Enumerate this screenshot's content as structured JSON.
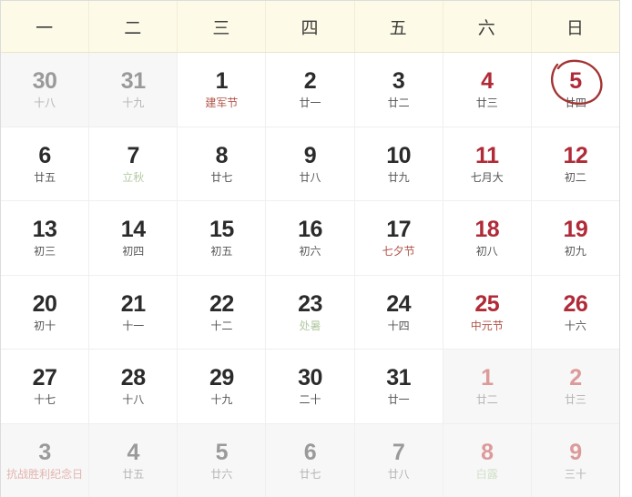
{
  "header": {
    "weekdays": [
      "一",
      "二",
      "三",
      "四",
      "五",
      "六",
      "日"
    ]
  },
  "colors": {
    "header_bg": "#fdfbe7",
    "out_bg": "#f7f7f7",
    "weekend_num": "#b02a37",
    "festival_text": "#b2554b",
    "solar_term_text": "#b4c9a4",
    "today_circle": "#a33434",
    "grid_line": "#efefef"
  },
  "today": {
    "number": "5",
    "marker": "circle"
  },
  "weeks": [
    [
      {
        "num": "30",
        "sub": "十八",
        "sub_type": "lunar",
        "out": true,
        "weekend": false,
        "today": false
      },
      {
        "num": "31",
        "sub": "十九",
        "sub_type": "lunar",
        "out": true,
        "weekend": false,
        "today": false
      },
      {
        "num": "1",
        "sub": "建军节",
        "sub_type": "festival",
        "out": false,
        "weekend": false,
        "today": false
      },
      {
        "num": "2",
        "sub": "廿一",
        "sub_type": "lunar",
        "out": false,
        "weekend": false,
        "today": false
      },
      {
        "num": "3",
        "sub": "廿二",
        "sub_type": "lunar",
        "out": false,
        "weekend": false,
        "today": false
      },
      {
        "num": "4",
        "sub": "廿三",
        "sub_type": "lunar",
        "out": false,
        "weekend": true,
        "today": false
      },
      {
        "num": "5",
        "sub": "廿四",
        "sub_type": "lunar",
        "out": false,
        "weekend": true,
        "today": true
      }
    ],
    [
      {
        "num": "6",
        "sub": "廿五",
        "sub_type": "lunar",
        "out": false,
        "weekend": false,
        "today": false
      },
      {
        "num": "7",
        "sub": "立秋",
        "sub_type": "term",
        "out": false,
        "weekend": false,
        "today": false
      },
      {
        "num": "8",
        "sub": "廿七",
        "sub_type": "lunar",
        "out": false,
        "weekend": false,
        "today": false
      },
      {
        "num": "9",
        "sub": "廿八",
        "sub_type": "lunar",
        "out": false,
        "weekend": false,
        "today": false
      },
      {
        "num": "10",
        "sub": "廿九",
        "sub_type": "lunar",
        "out": false,
        "weekend": false,
        "today": false
      },
      {
        "num": "11",
        "sub": "七月大",
        "sub_type": "lunar",
        "out": false,
        "weekend": true,
        "today": false
      },
      {
        "num": "12",
        "sub": "初二",
        "sub_type": "lunar",
        "out": false,
        "weekend": true,
        "today": false
      }
    ],
    [
      {
        "num": "13",
        "sub": "初三",
        "sub_type": "lunar",
        "out": false,
        "weekend": false,
        "today": false
      },
      {
        "num": "14",
        "sub": "初四",
        "sub_type": "lunar",
        "out": false,
        "weekend": false,
        "today": false
      },
      {
        "num": "15",
        "sub": "初五",
        "sub_type": "lunar",
        "out": false,
        "weekend": false,
        "today": false
      },
      {
        "num": "16",
        "sub": "初六",
        "sub_type": "lunar",
        "out": false,
        "weekend": false,
        "today": false
      },
      {
        "num": "17",
        "sub": "七夕节",
        "sub_type": "festival",
        "out": false,
        "weekend": false,
        "today": false
      },
      {
        "num": "18",
        "sub": "初八",
        "sub_type": "lunar",
        "out": false,
        "weekend": true,
        "today": false
      },
      {
        "num": "19",
        "sub": "初九",
        "sub_type": "lunar",
        "out": false,
        "weekend": true,
        "today": false
      }
    ],
    [
      {
        "num": "20",
        "sub": "初十",
        "sub_type": "lunar",
        "out": false,
        "weekend": false,
        "today": false
      },
      {
        "num": "21",
        "sub": "十一",
        "sub_type": "lunar",
        "out": false,
        "weekend": false,
        "today": false
      },
      {
        "num": "22",
        "sub": "十二",
        "sub_type": "lunar",
        "out": false,
        "weekend": false,
        "today": false
      },
      {
        "num": "23",
        "sub": "处暑",
        "sub_type": "term",
        "out": false,
        "weekend": false,
        "today": false
      },
      {
        "num": "24",
        "sub": "十四",
        "sub_type": "lunar",
        "out": false,
        "weekend": false,
        "today": false
      },
      {
        "num": "25",
        "sub": "中元节",
        "sub_type": "festival",
        "out": false,
        "weekend": true,
        "today": false
      },
      {
        "num": "26",
        "sub": "十六",
        "sub_type": "lunar",
        "out": false,
        "weekend": true,
        "today": false
      }
    ],
    [
      {
        "num": "27",
        "sub": "十七",
        "sub_type": "lunar",
        "out": false,
        "weekend": false,
        "today": false
      },
      {
        "num": "28",
        "sub": "十八",
        "sub_type": "lunar",
        "out": false,
        "weekend": false,
        "today": false
      },
      {
        "num": "29",
        "sub": "十九",
        "sub_type": "lunar",
        "out": false,
        "weekend": false,
        "today": false
      },
      {
        "num": "30",
        "sub": "二十",
        "sub_type": "lunar",
        "out": false,
        "weekend": false,
        "today": false
      },
      {
        "num": "31",
        "sub": "廿一",
        "sub_type": "lunar",
        "out": false,
        "weekend": false,
        "today": false
      },
      {
        "num": "1",
        "sub": "廿二",
        "sub_type": "lunar",
        "out": true,
        "weekend": true,
        "today": false
      },
      {
        "num": "2",
        "sub": "廿三",
        "sub_type": "lunar",
        "out": true,
        "weekend": true,
        "today": false
      }
    ],
    [
      {
        "num": "3",
        "sub": "抗战胜利纪念日",
        "sub_type": "festival",
        "out": true,
        "weekend": false,
        "today": false
      },
      {
        "num": "4",
        "sub": "廿五",
        "sub_type": "lunar",
        "out": true,
        "weekend": false,
        "today": false
      },
      {
        "num": "5",
        "sub": "廿六",
        "sub_type": "lunar",
        "out": true,
        "weekend": false,
        "today": false
      },
      {
        "num": "6",
        "sub": "廿七",
        "sub_type": "lunar",
        "out": true,
        "weekend": false,
        "today": false
      },
      {
        "num": "7",
        "sub": "廿八",
        "sub_type": "lunar",
        "out": true,
        "weekend": false,
        "today": false
      },
      {
        "num": "8",
        "sub": "白露",
        "sub_type": "term",
        "out": true,
        "weekend": true,
        "today": false
      },
      {
        "num": "9",
        "sub": "三十",
        "sub_type": "lunar",
        "out": true,
        "weekend": true,
        "today": false
      }
    ]
  ]
}
